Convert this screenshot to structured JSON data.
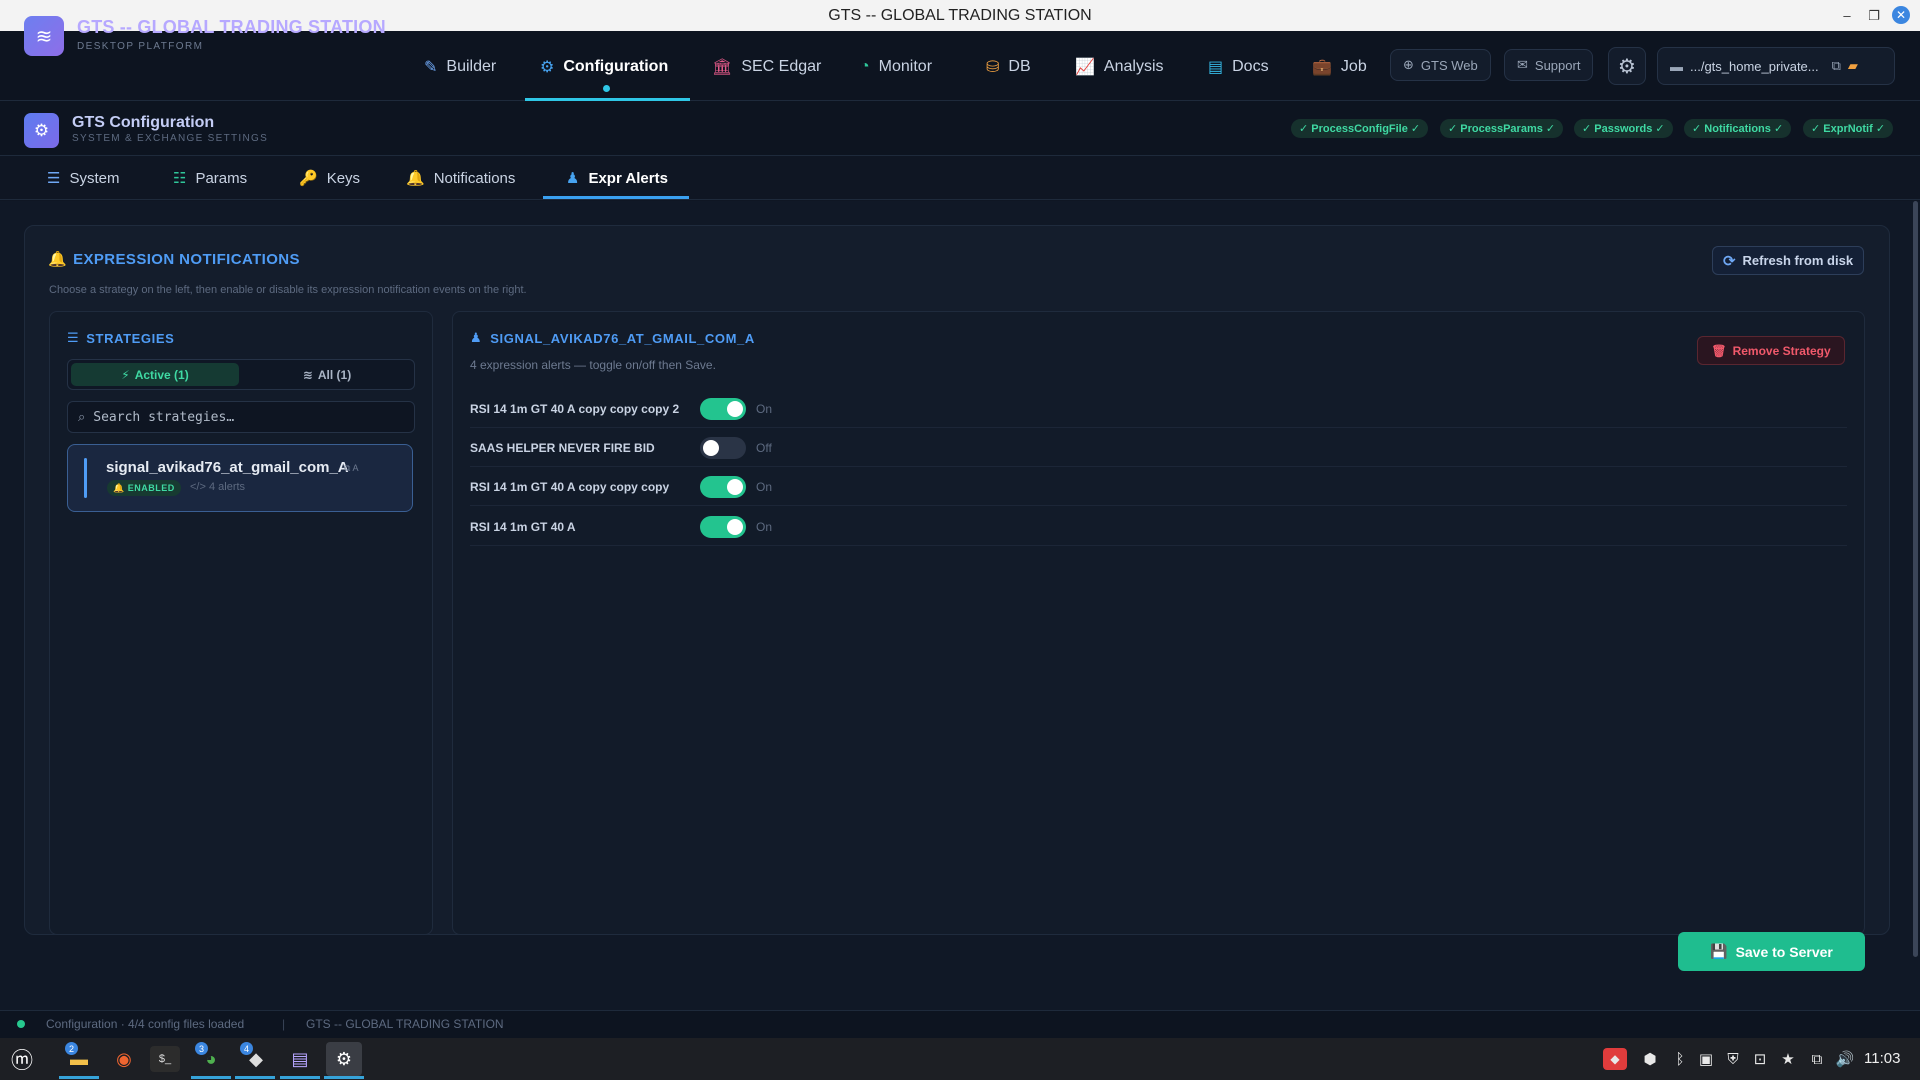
{
  "window": {
    "title": "GTS -- GLOBAL TRADING STATION"
  },
  "app": {
    "title": "GTS -- GLOBAL TRADING STATION",
    "subtitle": "DESKTOP PLATFORM"
  },
  "nav": {
    "items": [
      {
        "label": "Builder",
        "icon": "pen-icon"
      },
      {
        "label": "Configuration",
        "icon": "gear-icon"
      },
      {
        "label": "SEC Edgar",
        "icon": "bank-icon"
      },
      {
        "label": "Monitor",
        "icon": "gauge-icon"
      },
      {
        "label": "DB",
        "icon": "database-icon"
      },
      {
        "label": "Analysis",
        "icon": "chart-icon"
      },
      {
        "label": "Docs",
        "icon": "book-icon"
      },
      {
        "label": "Job",
        "icon": "briefcase-icon"
      }
    ],
    "active": "Configuration",
    "gts_web": "GTS Web",
    "support": "Support",
    "path": ".../gts_home_private..."
  },
  "config": {
    "title": "GTS Configuration",
    "subtitle": "SYSTEM & EXCHANGE SETTINGS",
    "badges": [
      "ProcessConfigFile",
      "ProcessParams",
      "Passwords",
      "Notifications",
      "ExprNotif"
    ]
  },
  "tabs": {
    "items": [
      {
        "label": "System"
      },
      {
        "label": "Params"
      },
      {
        "label": "Keys"
      },
      {
        "label": "Notifications"
      },
      {
        "label": "Expr Alerts"
      }
    ],
    "active": "Expr Alerts"
  },
  "expr": {
    "title": "EXPRESSION NOTIFICATIONS",
    "description": "Choose a strategy on the left, then enable or disable its expression notification events on the right.",
    "refresh_label": "Refresh from disk",
    "strategies": {
      "title": "STRATEGIES",
      "filter_active": "Active (1)",
      "filter_all": "All (1)",
      "search_placeholder": "Search strategies…",
      "items": [
        {
          "name": "signal_avikad76_at_gmail_com_A",
          "tag": "A",
          "status": "ENABLED",
          "alerts": "4 alerts"
        }
      ]
    },
    "detail": {
      "title": "SIGNAL_AVIKAD76_AT_GMAIL_COM_A",
      "description": "4 expression alerts — toggle on/off then Save.",
      "remove_label": "Remove Strategy",
      "alerts": [
        {
          "label": "RSI 14 1m GT 40 A copy copy copy 2",
          "state": "On",
          "enabled": true
        },
        {
          "label": "SAAS HELPER NEVER FIRE BID",
          "state": "Off",
          "enabled": false
        },
        {
          "label": "RSI 14 1m GT 40 A copy copy copy",
          "state": "On",
          "enabled": true
        },
        {
          "label": "RSI 14 1m GT 40 A",
          "state": "On",
          "enabled": true
        }
      ]
    },
    "save_label": "Save to Server"
  },
  "status": {
    "left": "Configuration · 4/4 config files loaded",
    "right": "GTS -- GLOBAL TRADING STATION"
  },
  "taskbar": {
    "badges": [
      "2",
      "3",
      "4"
    ],
    "clock": "11:03"
  },
  "colors": {
    "accent_blue": "#4f9cf5",
    "accent_green": "#23c48f",
    "danger": "#f1596b",
    "app_title": "#b6a8ff"
  }
}
